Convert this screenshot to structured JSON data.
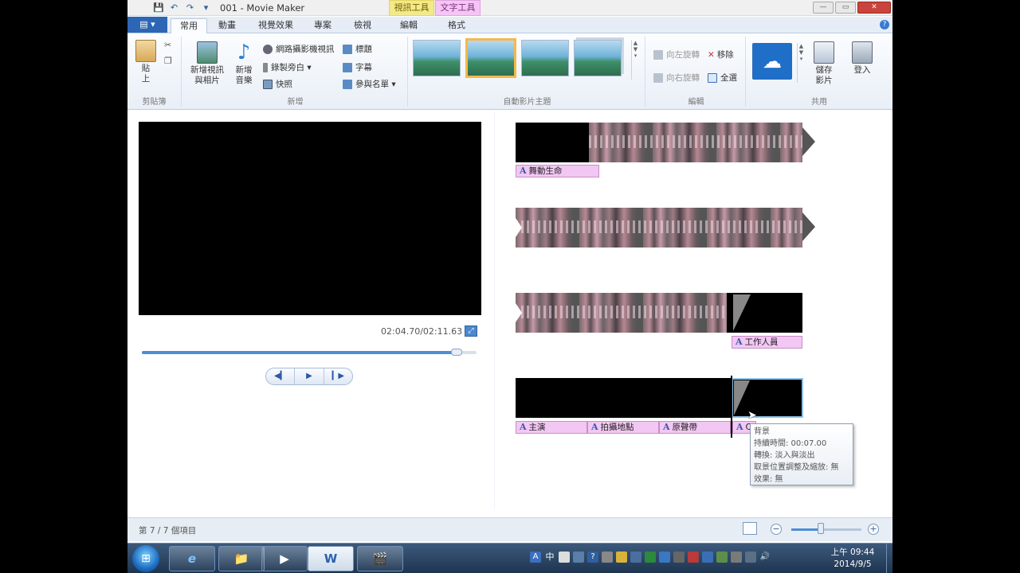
{
  "window": {
    "title": "001 - Movie Maker",
    "context_tab_video": "視訊工具",
    "context_tab_text": "文字工具",
    "win_buttons": [
      "—",
      "▭",
      "✕"
    ]
  },
  "quick_access": [
    "💾",
    "↶",
    "↷",
    "▾"
  ],
  "tabs": {
    "file": "▤ ▾",
    "items": [
      "常用",
      "動畫",
      "視覺效果",
      "專案",
      "檢視",
      "編輯",
      "格式"
    ],
    "active": "常用"
  },
  "ribbon": {
    "clipboard": {
      "paste": "貼上",
      "label": "剪貼簿"
    },
    "add": {
      "add_videos_photos": "新增視訊與相片",
      "add_music": "新增音樂",
      "webcam_video": "網路攝影機視訊",
      "record_narration": "錄製旁白",
      "snapshot": "快照",
      "title": "標題",
      "caption": "字幕",
      "credits": "參與名單",
      "label": "新增"
    },
    "automovie": {
      "label": "自動影片主題"
    },
    "editing": {
      "rotate_left": "向左旋轉",
      "rotate_right": "向右旋轉",
      "remove": "移除",
      "select_all": "全選",
      "label": "編輯"
    },
    "share": {
      "save_movie": "儲存影片",
      "sign_in": "登入",
      "label": "共用"
    }
  },
  "preview": {
    "timecode": "02:04.70/02:11.63",
    "progress": 0.94,
    "controls": [
      "◀▎",
      "▶",
      "▎▶"
    ]
  },
  "storyboard": {
    "captions": {
      "row1": "舞動生命",
      "row3": "工作人員",
      "row4_a": "主演",
      "row4_b": "拍攝地點",
      "row4_c": "原聲帶",
      "row4_d": "C"
    },
    "caption_glyph": "A"
  },
  "tooltip": {
    "line1": "背景",
    "line2": "持續時間: 00:07.00",
    "line3": "轉換: 淡入與淡出",
    "line4": "取景位置調整及縮放: 無",
    "line5": "效果: 無"
  },
  "statusbar": {
    "status": "第 7 / 7 個項目",
    "zoom_minus": "−",
    "zoom_plus": "+",
    "zoom_level": 0.42
  },
  "taskbar": {
    "start": "⊞",
    "apps": [
      "e",
      "📁",
      "▶",
      "W",
      "🎬"
    ],
    "tray": [
      "中"
    ],
    "time": "上午 09:44",
    "date": "2014/9/5"
  },
  "colors": {
    "ribbon_accent": "#2c66b5",
    "caption_pink": "#f3c7f3",
    "context_video": "#f4e989",
    "context_text": "#f5c6f5"
  }
}
